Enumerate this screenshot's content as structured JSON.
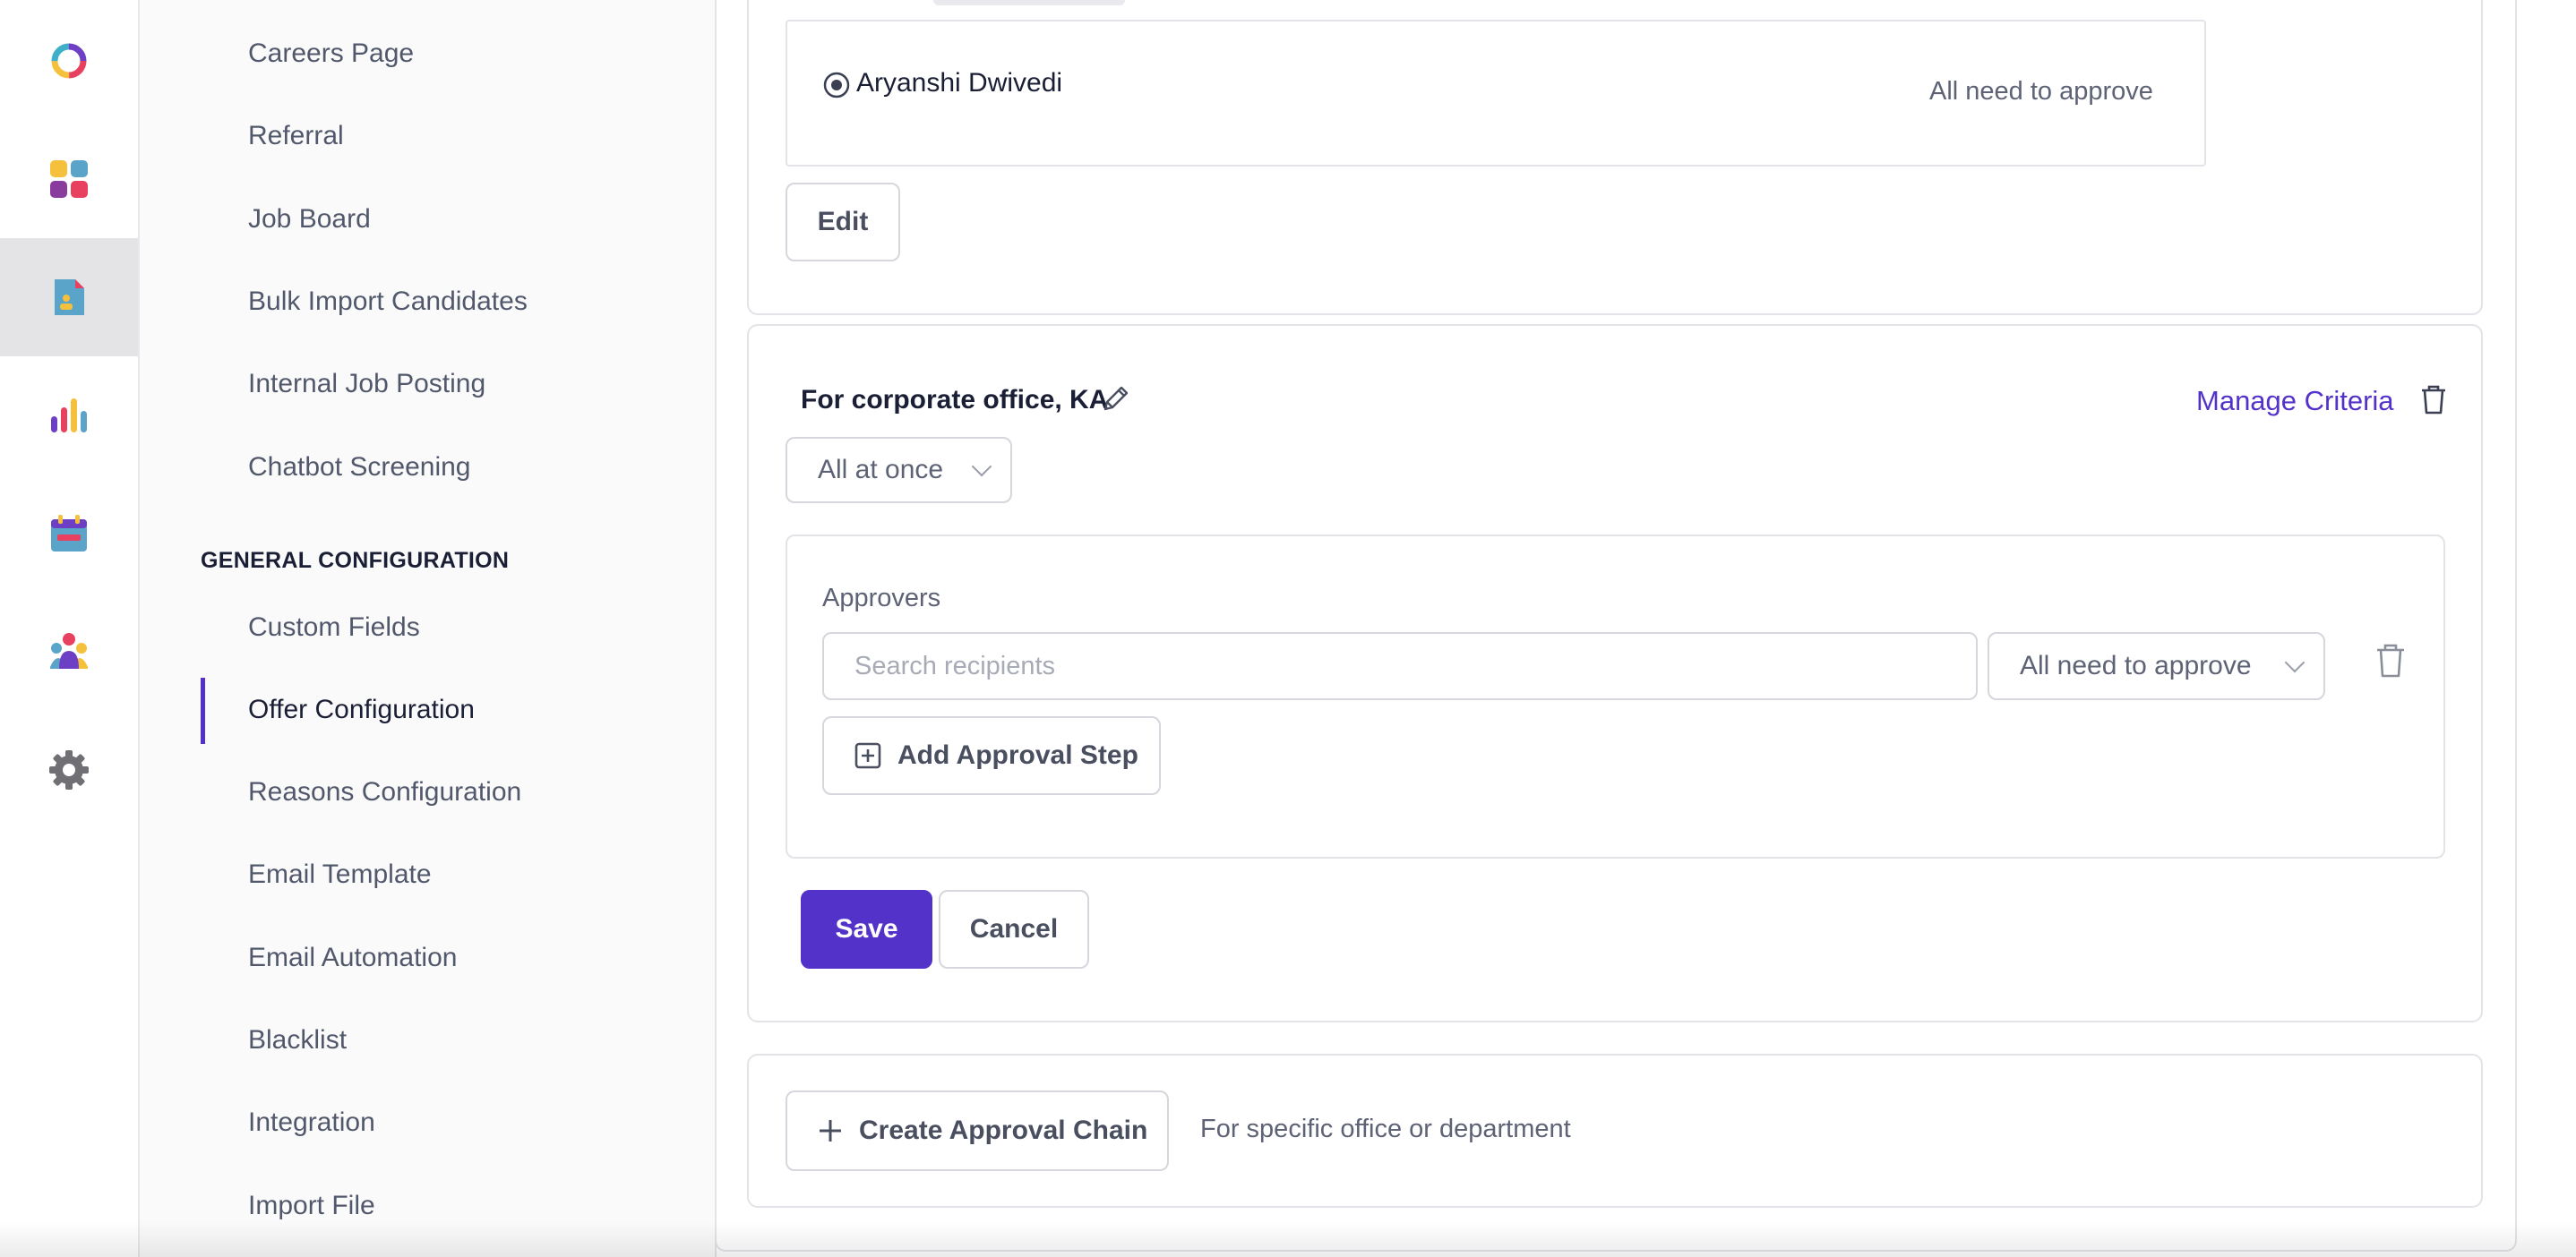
{
  "rail": {
    "items": [
      {
        "name": "app-logo-icon"
      },
      {
        "name": "dashboard-icon"
      },
      {
        "name": "jobs-document-icon",
        "active": true
      },
      {
        "name": "reports-chart-icon"
      },
      {
        "name": "calendar-icon"
      },
      {
        "name": "team-icon"
      },
      {
        "name": "settings-gear-icon"
      }
    ]
  },
  "sidebar": {
    "items_top": [
      {
        "label": "Careers Page"
      },
      {
        "label": "Referral"
      },
      {
        "label": "Job Board"
      },
      {
        "label": "Bulk Import Candidates"
      },
      {
        "label": "Internal Job Posting"
      },
      {
        "label": "Chatbot Screening"
      }
    ],
    "section_heading": "GENERAL CONFIGURATION",
    "items_bottom": [
      {
        "label": "Custom Fields"
      },
      {
        "label": "Offer Configuration",
        "active": true
      },
      {
        "label": "Reasons Configuration"
      },
      {
        "label": "Email Template"
      },
      {
        "label": "Email Automation"
      },
      {
        "label": "Blacklist"
      },
      {
        "label": "Integration"
      },
      {
        "label": "Import File"
      }
    ]
  },
  "chain1": {
    "approver_name": "Aryanshi Dwivedi",
    "approval_rule": "All need to approve",
    "edit_label": "Edit"
  },
  "chain2": {
    "title": "For corporate office, KA",
    "manage_criteria": "Manage Criteria",
    "mode_select": "All at once",
    "approvers_label": "Approvers",
    "search_placeholder": "Search recipients",
    "rule_select": "All need to approve",
    "add_step_label": "Add Approval Step",
    "save_label": "Save",
    "cancel_label": "Cancel"
  },
  "create": {
    "button_label": "Create Approval Chain",
    "hint": "For specific office or department"
  },
  "colors": {
    "accent": "#5332c9",
    "text_primary": "#1a1f36",
    "text_secondary": "#52586c",
    "border": "#e3e3e8"
  }
}
